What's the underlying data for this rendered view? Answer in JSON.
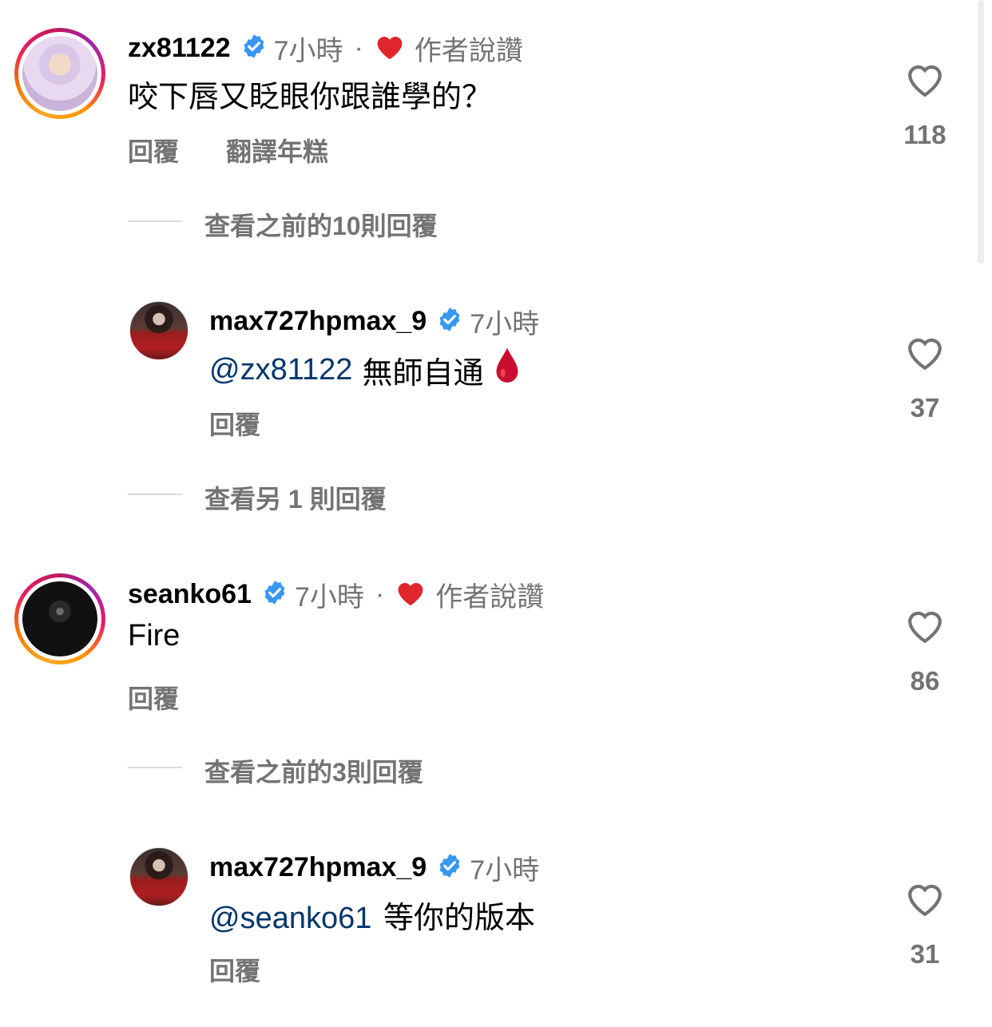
{
  "colors": {
    "mention": "#00376b",
    "secondary": "#737373",
    "verified": "#3897f0",
    "liked_heart": "#e0252d"
  },
  "comments": [
    {
      "username": "zx81122",
      "time": "7小時",
      "separator": "·",
      "liked_by_author": "作者說讚",
      "text": "咬下唇又眨眼你跟誰學的？",
      "reply_label": "回覆",
      "translate_label": "翻譯年糕",
      "likes": "118",
      "view_replies": "查看之前的10則回覆",
      "reply": {
        "username": "max727hpmax_9",
        "time": "7小時",
        "mention": "@zx81122",
        "text": "無師自通",
        "emoji": "drop-of-blood-icon",
        "reply_label": "回覆",
        "likes": "37",
        "view_replies": "查看另 1 則回覆"
      }
    },
    {
      "username": "seanko61",
      "time": "7小時",
      "separator": "·",
      "liked_by_author": "作者說讚",
      "text": "Fire",
      "reply_label": "回覆",
      "likes": "86",
      "view_replies": "查看之前的3則回覆",
      "reply": {
        "username": "max727hpmax_9",
        "time": "7小時",
        "mention": "@seanko61",
        "text": "等你的版本",
        "reply_label": "回覆",
        "likes": "31"
      }
    }
  ]
}
